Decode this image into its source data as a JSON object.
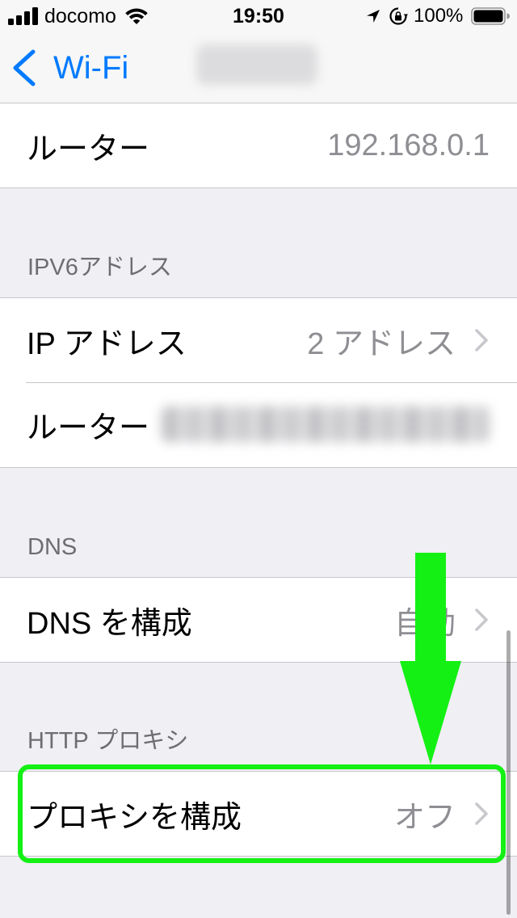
{
  "theme": {
    "background": "#EFEFF4",
    "bar_background": "#F7F7F7",
    "cell_background": "#FFFFFF",
    "accent": "#007AFF",
    "secondary_text": "#8E8E93",
    "header_text": "#6D6D72",
    "separator": "#C8C7CC",
    "chevron": "#C7C7CC",
    "annotation_green": "#14F014"
  },
  "status_bar": {
    "carrier": "docomo",
    "time": "19:50",
    "battery_text": "100%",
    "battery_level": 1.0,
    "signal_bars": 4,
    "icons": {
      "signal": "cellular-signal-icon",
      "wifi": "wifi-icon",
      "location": "location-arrow-icon",
      "orientation_lock": "orientation-lock-icon",
      "battery": "battery-icon"
    }
  },
  "nav": {
    "back_label": "Wi-Fi",
    "back_icon": "chevron-left-icon"
  },
  "sections": [
    {
      "rows": [
        {
          "label": "ルーター",
          "value": "192.168.0.1",
          "chevron": false
        }
      ]
    },
    {
      "header": "IPV6アドレス",
      "rows": [
        {
          "label": "IP アドレス",
          "value": "2 アドレス",
          "chevron": true
        },
        {
          "label": "ルーター",
          "chevron": false
        }
      ]
    },
    {
      "header": "DNS",
      "rows": [
        {
          "label": "DNS を構成",
          "value": "自動",
          "chevron": true
        }
      ]
    },
    {
      "header": "HTTP プロキシ",
      "rows": [
        {
          "label": "プロキシを構成",
          "value": "オフ",
          "chevron": true
        }
      ]
    }
  ],
  "row_icon": "chevron-right-icon"
}
